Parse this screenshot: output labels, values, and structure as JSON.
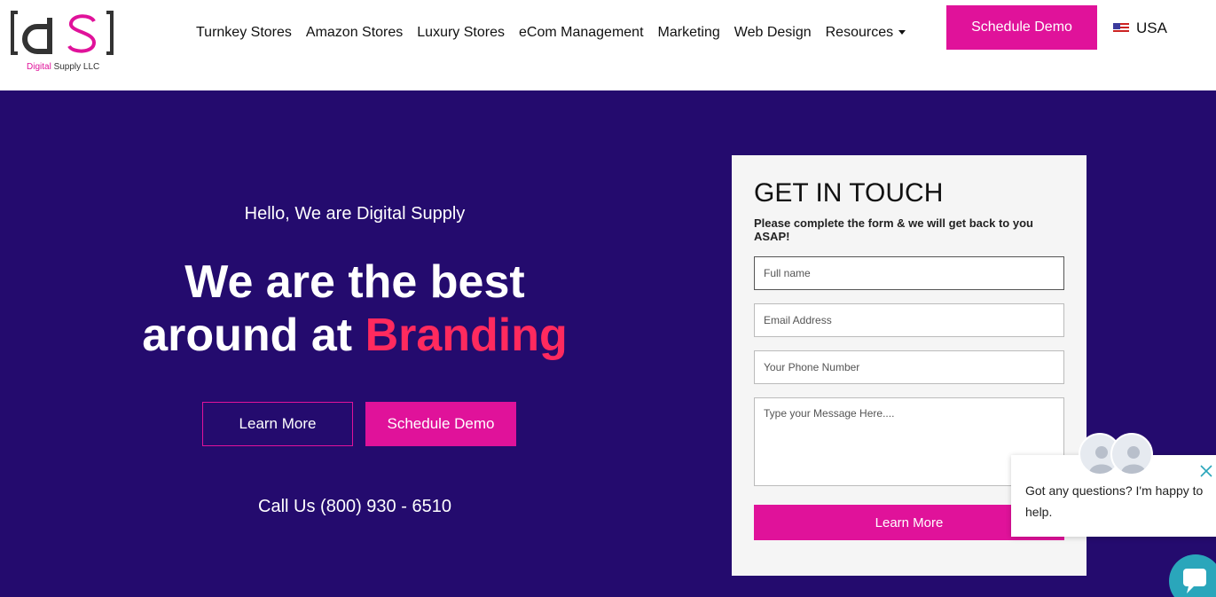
{
  "header": {
    "logo": {
      "company": "Digital",
      "company_rest": " Supply LLC"
    },
    "nav": [
      {
        "label": "Turnkey Stores"
      },
      {
        "label": "Amazon Stores"
      },
      {
        "label": "Luxury Stores"
      },
      {
        "label": "eCom Management"
      },
      {
        "label": "Marketing"
      },
      {
        "label": "Web Design"
      },
      {
        "label": "Resources"
      }
    ],
    "cta_label": "Schedule Demo",
    "locale": "USA"
  },
  "hero": {
    "greeting": "Hello, We are Digital Supply",
    "headline_line1": "We are the best",
    "headline_line2_prefix": "around at ",
    "headline_highlight": "Branding",
    "learn_more_label": "Learn More",
    "schedule_demo_label": "Schedule Demo",
    "call": "Call Us (800) 930 - 6510"
  },
  "form": {
    "title": "GET IN TOUCH",
    "subtitle": "Please complete the form & we will get back to you ASAP!",
    "fields": [
      {
        "placeholder": "Full name",
        "value": ""
      },
      {
        "placeholder": "Email Address",
        "value": ""
      },
      {
        "placeholder": "Your Phone Number",
        "value": ""
      },
      {
        "placeholder": "Type your Message Here....",
        "value": ""
      }
    ],
    "submit_label": "Learn More"
  },
  "chat": {
    "message": "Got any questions? I'm happy to help."
  },
  "colors": {
    "brand_pink": "#e0129a",
    "hero_bg": "#240b6e",
    "highlight": "#ff2a5e",
    "chat_teal": "#2aa6bb"
  }
}
